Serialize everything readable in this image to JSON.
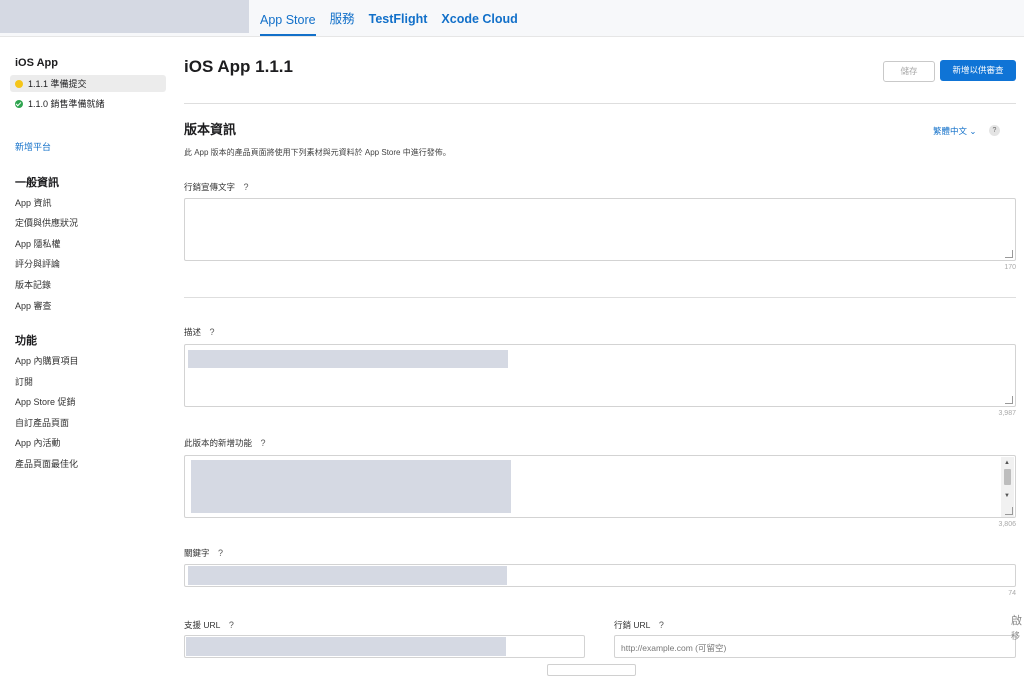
{
  "topnav": {
    "tabs": [
      {
        "label": "App Store"
      },
      {
        "label": "服務"
      },
      {
        "label": "TestFlight"
      },
      {
        "label": "Xcode Cloud"
      }
    ]
  },
  "sidebar": {
    "app_title": "iOS App",
    "versions": [
      {
        "label": "1.1.1 準備提交",
        "status": "yellow"
      },
      {
        "label": "1.1.0 銷售準備就緒",
        "status": "green"
      }
    ],
    "add_platform": "新增平台",
    "general_title": "一般資訊",
    "general_items": [
      "App 資訊",
      "定價與供應狀況",
      "App 隱私權",
      "評分與評論",
      "版本記錄",
      "App 審查"
    ],
    "features_title": "功能",
    "features_items": [
      "App 內購買項目",
      "訂閱",
      "App Store 促銷",
      "自訂產品頁面",
      "App 內活動",
      "產品頁面最佳化"
    ]
  },
  "header": {
    "title": "iOS App 1.1.1",
    "save_label": "儲存",
    "submit_label": "新增以供審查"
  },
  "version_info": {
    "title": "版本資訊",
    "language": "繁體中文",
    "help": "?",
    "description": "此 App 版本的產品頁面將使用下列素材與元資料於 App Store 中進行發佈。"
  },
  "fields": {
    "promo_label": "行銷宣傳文字",
    "promo_counter": "170",
    "desc_label": "描述",
    "desc_counter": "3,987",
    "whatsnew_label": "此版本的新增功能",
    "whatsnew_counter": "3,806",
    "keywords_label": "關鍵字",
    "keywords_counter": "74",
    "support_label": "支援 URL",
    "marketing_label": "行銷 URL",
    "marketing_placeholder": "http://example.com (可留空)",
    "help": "?"
  },
  "edge": {
    "char1": "啟",
    "char2": "移"
  }
}
